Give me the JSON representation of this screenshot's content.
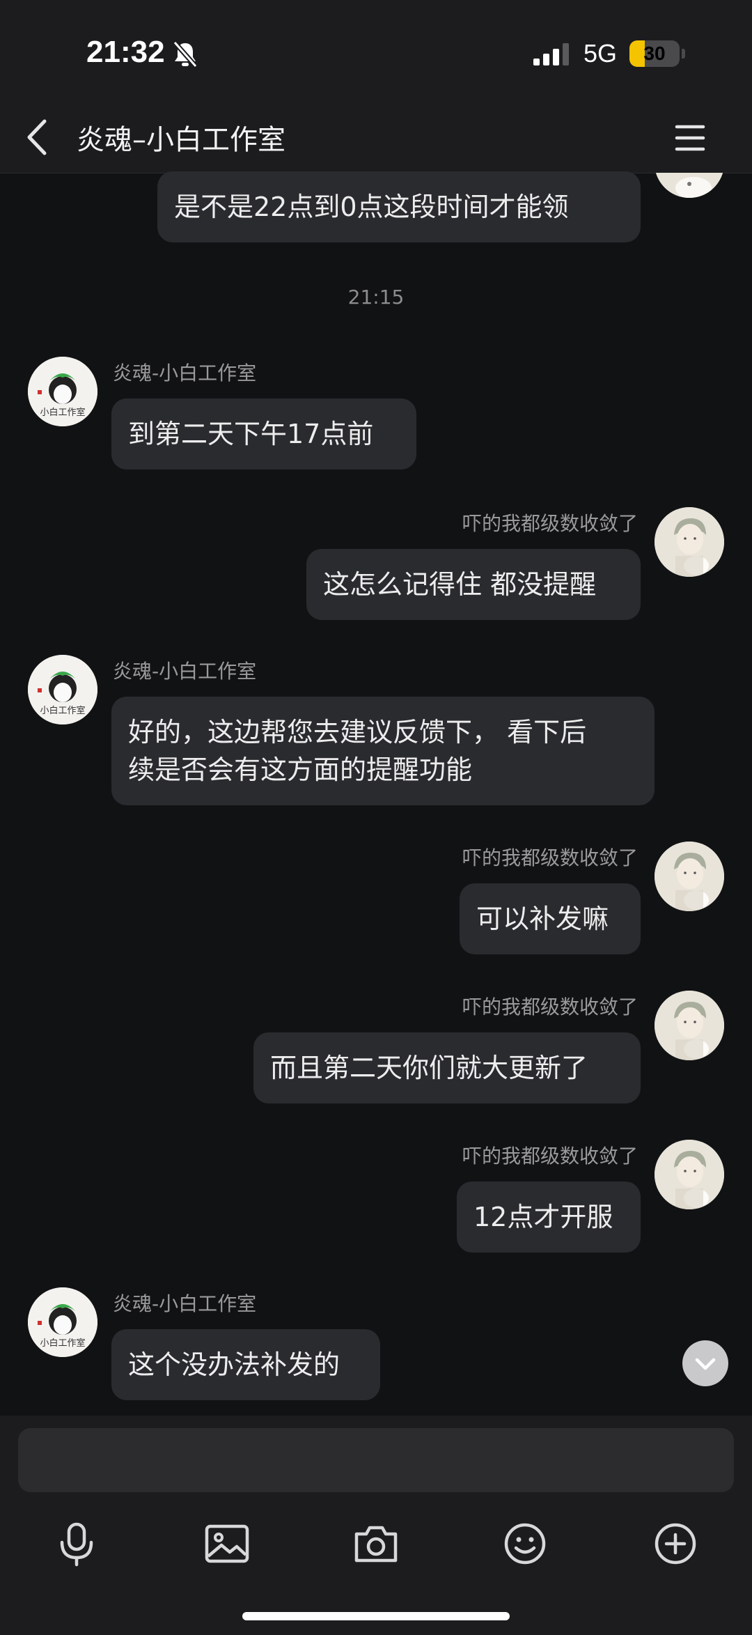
{
  "status_bar": {
    "time": "21:32",
    "network": "5G",
    "battery": "30",
    "battery_level": 0.3
  },
  "header": {
    "title": "炎魂–小白工作室"
  },
  "time_divider": "21:15",
  "messages": [
    {
      "side": "right",
      "text": "是不是22点到0点这段时间才能领"
    },
    {
      "side": "left",
      "sender": "炎魂-小白工作室",
      "text": "到第二天下午17点前"
    },
    {
      "side": "right",
      "sender": "吓的我都级数收敛了",
      "text": "这怎么记得住 都没提醒"
    },
    {
      "side": "left",
      "sender": "炎魂-小白工作室",
      "lines": [
        "好的，这边帮您去建议反馈下， 看下后",
        "续是否会有这方面的提醒功能"
      ]
    },
    {
      "side": "right",
      "sender": "吓的我都级数收敛了",
      "text": "可以补发嘛"
    },
    {
      "side": "right",
      "sender": "吓的我都级数收敛了",
      "text": "而且第二天你们就大更新了"
    },
    {
      "side": "right",
      "sender": "吓的我都级数收敛了",
      "text": "12点才开服"
    },
    {
      "side": "left",
      "sender": "炎魂-小白工作室",
      "text": "这个没办法补发的"
    }
  ],
  "avatars": {
    "studio_text": "小白工作室"
  },
  "input": {
    "placeholder": ""
  },
  "icons": [
    "microphone-icon",
    "image-icon",
    "camera-icon",
    "emoji-icon",
    "plus-icon",
    "chevron-down-icon",
    "back-arrow-icon",
    "menu-icon",
    "bell-slash-icon",
    "signal-icon"
  ],
  "colors": {
    "background": "#111214",
    "bubble": "#2a2b2e",
    "bar": "#1c1c1e",
    "battery_fill": "#f5c400"
  }
}
